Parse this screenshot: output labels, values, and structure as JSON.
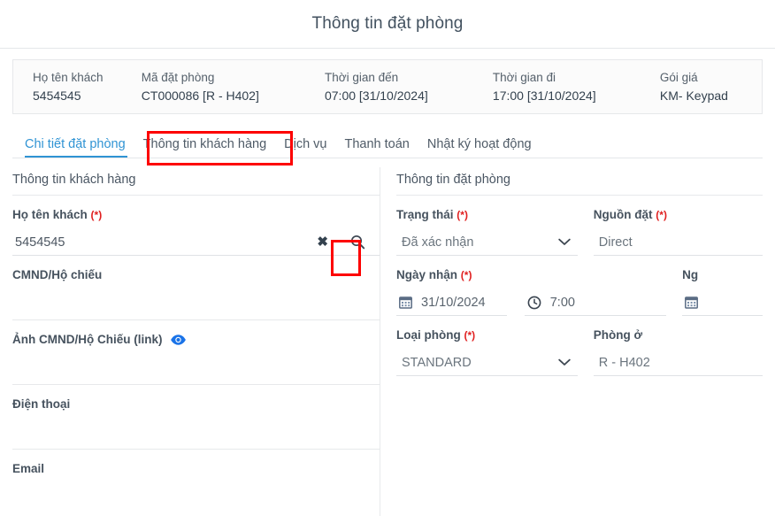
{
  "page_title": "Thông tin đặt phòng",
  "summary": {
    "columns": [
      {
        "label": "Họ tên khách",
        "value": "5454545"
      },
      {
        "label": "Mã đặt phòng",
        "value": "CT000086 [R - H402]"
      },
      {
        "label": "Thời gian đến",
        "value": "07:00 [31/10/2024]"
      },
      {
        "label": "Thời gian đi",
        "value": "17:00 [31/10/2024]"
      },
      {
        "label": "Gói giá",
        "value": "KM- Keypad"
      }
    ]
  },
  "tabs": [
    {
      "label": "Chi tiết đặt phòng",
      "active": true
    },
    {
      "label": "Thông tin khách hàng",
      "active": false
    },
    {
      "label": "Dịch vụ",
      "active": false
    },
    {
      "label": "Thanh toán",
      "active": false
    },
    {
      "label": "Nhật ký hoạt động",
      "active": false
    }
  ],
  "left_panel": {
    "section_title": "Thông tin khách hàng",
    "guest_name": {
      "label": "Họ tên khách",
      "required": "(*)",
      "value": "5454545",
      "clear_icon": "close-icon",
      "search_icon": "search-icon"
    },
    "id_number": {
      "label": "CMND/Hộ chiếu",
      "value": ""
    },
    "id_photo": {
      "label": "Ảnh CMND/Hộ Chiếu (link)",
      "eye_icon": "eye-icon",
      "value": ""
    },
    "phone": {
      "label": "Điện thoại",
      "value": ""
    },
    "email": {
      "label": "Email",
      "value": ""
    }
  },
  "right_panel": {
    "section_title": "Thông tin đặt phòng",
    "status": {
      "label": "Trạng thái",
      "required": "(*)",
      "value": "Đã xác nhận",
      "chevron": "chevron-down-icon"
    },
    "source": {
      "label": "Nguồn đặt",
      "required": "(*)",
      "value": "Direct"
    },
    "checkin_date": {
      "label": "Ngày nhận",
      "required": "(*)",
      "value": "31/10/2024",
      "icon": "calendar-icon"
    },
    "checkin_time": {
      "value": "7:00",
      "icon": "clock-icon"
    },
    "checkout_date": {
      "label": "Ng",
      "icon": "calendar-icon",
      "value": ""
    },
    "room_type": {
      "label": "Loại phòng",
      "required": "(*)",
      "value": "STANDARD",
      "chevron": "chevron-down-icon"
    },
    "room": {
      "label": "Phòng ở",
      "value": "R - H402"
    }
  },
  "colors": {
    "accent_blue": "#3094d4",
    "highlight_red": "#fd0000",
    "required_red": "#e02020",
    "eye_blue": "#1a73e8",
    "text_dark": "#3c4858"
  }
}
